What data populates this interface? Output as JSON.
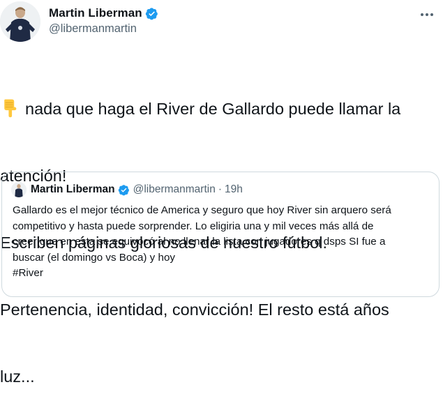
{
  "tweet": {
    "author": {
      "name": "Martin Liberman",
      "handle": "@libermanmartin",
      "avatar_icon": "person-avatar"
    },
    "emoji": "backhand-index-pointing-down",
    "text_lines": [
      "nada que haga el River de Gallardo puede llamar la",
      "atención!",
      "Escriben páginas gloriosas de nuestro fútbol.",
      "Pertenencia, identidad, convicción! El resto está años",
      "luz..."
    ]
  },
  "quoted_tweet": {
    "author": {
      "name": "Martin Liberman",
      "handle": "@libermanmartin",
      "separator": "·",
      "time": "19h"
    },
    "text_lines": [
      "Gallardo es el mejor técnico de America y seguro que hoy River sin arquero será",
      "competitivo y hasta puede sorprender. Lo eligiria una y mil veces más allá de",
      "creer que en esta se equivocó al no llenar la lista con jugadores q dsps SI fue a",
      "buscar (el domingo vs Boca) y hoy",
      "#River"
    ]
  },
  "colors": {
    "verified": "#1d9bf0",
    "secondary_text": "#536471",
    "border": "#cfd9de"
  }
}
